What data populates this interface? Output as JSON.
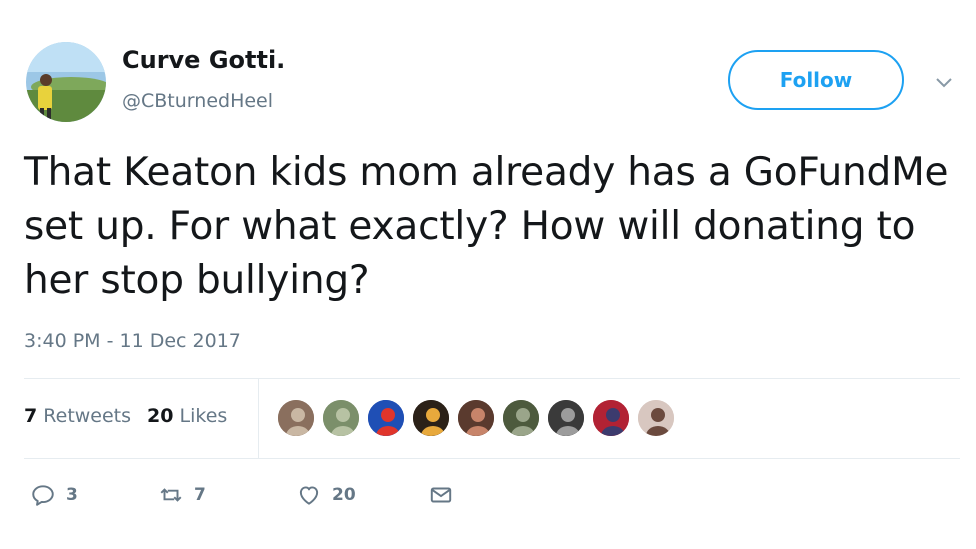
{
  "user": {
    "name": "Curve Gotti.",
    "handle": "@CBturnedHeel"
  },
  "follow_label": "Follow",
  "tweet": {
    "text": "That Keaton kids mom already has a GoFundMe set up. For what exactly? How will donating to her stop bullying?",
    "timestamp": "3:40 PM - 11 Dec 2017"
  },
  "stats": {
    "retweets_count": "7",
    "retweets_label": "Retweets",
    "likes_count": "20",
    "likes_label": "Likes"
  },
  "actions": {
    "reply_count": "3",
    "retweet_count": "7",
    "like_count": "20"
  },
  "colors": {
    "accent": "#1da1f2",
    "muted": "#657786",
    "text": "#14171a",
    "divider": "#e6ecf0"
  },
  "likers": [
    {
      "name": "liker-1",
      "bg": "#8a6f5e",
      "fg": "#c9b7a3"
    },
    {
      "name": "liker-2",
      "bg": "#7b8f6a",
      "fg": "#b7c2a3"
    },
    {
      "name": "liker-3",
      "bg": "#1f4fb5",
      "fg": "#e0352b"
    },
    {
      "name": "liker-4",
      "bg": "#2b2118",
      "fg": "#e8a93c"
    },
    {
      "name": "liker-5",
      "bg": "#5a3a2e",
      "fg": "#c7846a"
    },
    {
      "name": "liker-6",
      "bg": "#4d5a3d",
      "fg": "#9aa58a"
    },
    {
      "name": "liker-7",
      "bg": "#3a3a3a",
      "fg": "#9c9c9c"
    },
    {
      "name": "liker-8",
      "bg": "#b22234",
      "fg": "#3c3b6e"
    },
    {
      "name": "liker-9",
      "bg": "#d8c7c0",
      "fg": "#6b4a3e"
    }
  ]
}
